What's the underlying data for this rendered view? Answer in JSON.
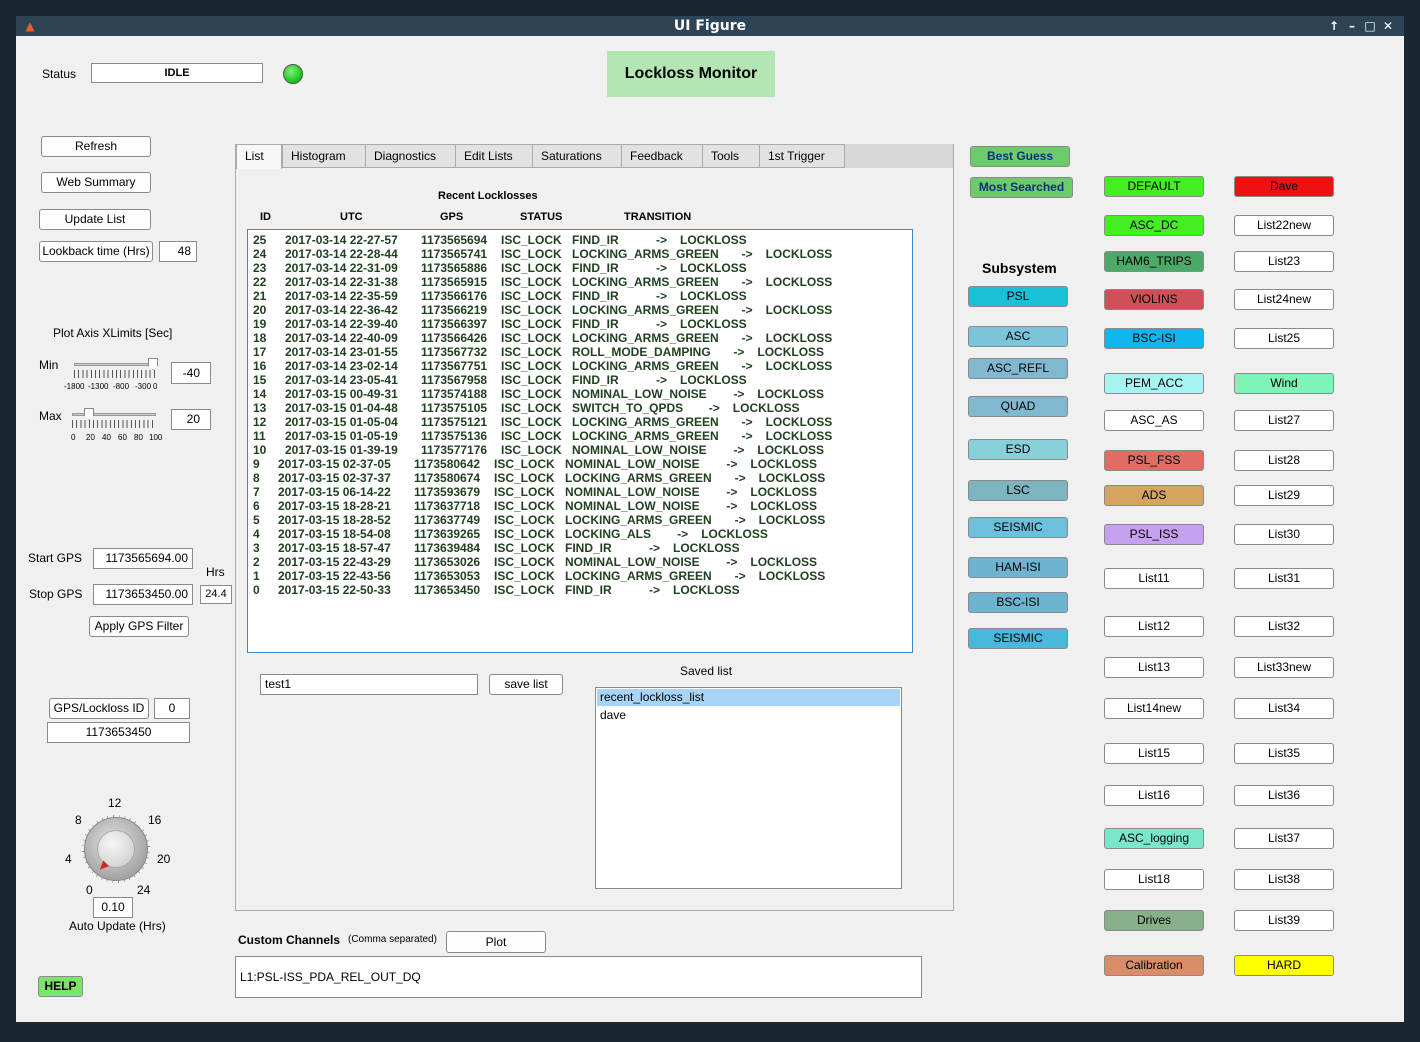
{
  "window": {
    "title": "UI Figure"
  },
  "status": {
    "label": "Status",
    "value": "IDLE",
    "indicator_color": "#22cc22"
  },
  "header": {
    "title": "Lockloss Monitor",
    "title_bg": "#b4e6b4"
  },
  "left": {
    "refresh": "Refresh",
    "web_summary": "Web Summary",
    "update_list": "Update List",
    "lookback_label": "Lookback time (Hrs)",
    "lookback_value": "48",
    "plot_axis_title": "Plot Axis XLimits [Sec]",
    "min_label": "Min",
    "min_value": "-40",
    "min_ticks": [
      "-1800",
      "-1300",
      "-800",
      "-300",
      "0"
    ],
    "max_label": "Max",
    "max_value": "20",
    "max_ticks": [
      "0",
      "20",
      "40",
      "60",
      "80",
      "100"
    ],
    "start_gps_label": "Start GPS",
    "start_gps_value": "1173565694.00",
    "stop_gps_label": "Stop GPS",
    "stop_gps_value": "1173653450.00",
    "hrs_label": "Hrs",
    "hrs_value": "24.4",
    "apply_gps": "Apply GPS Filter",
    "gps_id_label": "GPS/Lockloss ID",
    "gps_id_value": "0",
    "gps_value": "1173653450",
    "dial_ticks": [
      "0",
      "4",
      "8",
      "12",
      "16",
      "20",
      "24"
    ],
    "auto_update_value": "0.10",
    "auto_update_label": "Auto Update (Hrs)",
    "help": "HELP"
  },
  "tabs": [
    "List",
    "Histogram",
    "Diagnostics",
    "Edit Lists",
    "Saturations",
    "Feedback",
    "Tools",
    "1st Trigger"
  ],
  "list_panel": {
    "title": "Recent Locklosses",
    "columns": [
      "ID",
      "UTC",
      "GPS",
      "STATUS",
      "TRANSITION"
    ],
    "rows": [
      {
        "id": "25",
        "utc": "2017-03-14 22-27-57",
        "gps": "1173565694",
        "status": "ISC_LOCK",
        "from": "FIND_IR",
        "to": "LOCKLOSS"
      },
      {
        "id": "24",
        "utc": "2017-03-14 22-28-44",
        "gps": "1173565741",
        "status": "ISC_LOCK",
        "from": "LOCKING_ARMS_GREEN",
        "to": "LOCKLOSS"
      },
      {
        "id": "23",
        "utc": "2017-03-14 22-31-09",
        "gps": "1173565886",
        "status": "ISC_LOCK",
        "from": "FIND_IR",
        "to": "LOCKLOSS"
      },
      {
        "id": "22",
        "utc": "2017-03-14 22-31-38",
        "gps": "1173565915",
        "status": "ISC_LOCK",
        "from": "LOCKING_ARMS_GREEN",
        "to": "LOCKLOSS"
      },
      {
        "id": "21",
        "utc": "2017-03-14 22-35-59",
        "gps": "1173566176",
        "status": "ISC_LOCK",
        "from": "FIND_IR",
        "to": "LOCKLOSS"
      },
      {
        "id": "20",
        "utc": "2017-03-14 22-36-42",
        "gps": "1173566219",
        "status": "ISC_LOCK",
        "from": "LOCKING_ARMS_GREEN",
        "to": "LOCKLOSS"
      },
      {
        "id": "19",
        "utc": "2017-03-14 22-39-40",
        "gps": "1173566397",
        "status": "ISC_LOCK",
        "from": "FIND_IR",
        "to": "LOCKLOSS"
      },
      {
        "id": "18",
        "utc": "2017-03-14 22-40-09",
        "gps": "1173566426",
        "status": "ISC_LOCK",
        "from": "LOCKING_ARMS_GREEN",
        "to": "LOCKLOSS"
      },
      {
        "id": "17",
        "utc": "2017-03-14 23-01-55",
        "gps": "1173567732",
        "status": "ISC_LOCK",
        "from": "ROLL_MODE_DAMPING",
        "to": "LOCKLOSS"
      },
      {
        "id": "16",
        "utc": "2017-03-14 23-02-14",
        "gps": "1173567751",
        "status": "ISC_LOCK",
        "from": "LOCKING_ARMS_GREEN",
        "to": "LOCKLOSS"
      },
      {
        "id": "15",
        "utc": "2017-03-14 23-05-41",
        "gps": "1173567958",
        "status": "ISC_LOCK",
        "from": "FIND_IR",
        "to": "LOCKLOSS"
      },
      {
        "id": "14",
        "utc": "2017-03-15 00-49-31",
        "gps": "1173574188",
        "status": "ISC_LOCK",
        "from": "NOMINAL_LOW_NOISE",
        "to": "LOCKLOSS"
      },
      {
        "id": "13",
        "utc": "2017-03-15 01-04-48",
        "gps": "1173575105",
        "status": "ISC_LOCK",
        "from": "SWITCH_TO_QPDS",
        "to": "LOCKLOSS"
      },
      {
        "id": "12",
        "utc": "2017-03-15 01-05-04",
        "gps": "1173575121",
        "status": "ISC_LOCK",
        "from": "LOCKING_ARMS_GREEN",
        "to": "LOCKLOSS"
      },
      {
        "id": "11",
        "utc": "2017-03-15 01-05-19",
        "gps": "1173575136",
        "status": "ISC_LOCK",
        "from": "LOCKING_ARMS_GREEN",
        "to": "LOCKLOSS"
      },
      {
        "id": "10",
        "utc": "2017-03-15 01-39-19",
        "gps": "1173577176",
        "status": "ISC_LOCK",
        "from": "NOMINAL_LOW_NOISE",
        "to": "LOCKLOSS"
      },
      {
        "id": "9",
        "utc": "2017-03-15 02-37-05",
        "gps": "1173580642",
        "status": "ISC_LOCK",
        "from": "NOMINAL_LOW_NOISE",
        "to": "LOCKLOSS"
      },
      {
        "id": "8",
        "utc": "2017-03-15 02-37-37",
        "gps": "1173580674",
        "status": "ISC_LOCK",
        "from": "LOCKING_ARMS_GREEN",
        "to": "LOCKLOSS"
      },
      {
        "id": "7",
        "utc": "2017-03-15 06-14-22",
        "gps": "1173593679",
        "status": "ISC_LOCK",
        "from": "NOMINAL_LOW_NOISE",
        "to": "LOCKLOSS"
      },
      {
        "id": "6",
        "utc": "2017-03-15 18-28-21",
        "gps": "1173637718",
        "status": "ISC_LOCK",
        "from": "NOMINAL_LOW_NOISE",
        "to": "LOCKLOSS"
      },
      {
        "id": "5",
        "utc": "2017-03-15 18-28-52",
        "gps": "1173637749",
        "status": "ISC_LOCK",
        "from": "LOCKING_ARMS_GREEN",
        "to": "LOCKLOSS"
      },
      {
        "id": "4",
        "utc": "2017-03-15 18-54-08",
        "gps": "1173639265",
        "status": "ISC_LOCK",
        "from": "LOCKING_ALS",
        "to": "LOCKLOSS"
      },
      {
        "id": "3",
        "utc": "2017-03-15 18-57-47",
        "gps": "1173639484",
        "status": "ISC_LOCK",
        "from": "FIND_IR",
        "to": "LOCKLOSS"
      },
      {
        "id": "2",
        "utc": "2017-03-15 22-43-29",
        "gps": "1173653026",
        "status": "ISC_LOCK",
        "from": "NOMINAL_LOW_NOISE",
        "to": "LOCKLOSS"
      },
      {
        "id": "1",
        "utc": "2017-03-15 22-43-56",
        "gps": "1173653053",
        "status": "ISC_LOCK",
        "from": "LOCKING_ARMS_GREEN",
        "to": "LOCKLOSS"
      },
      {
        "id": "0",
        "utc": "2017-03-15 22-50-33",
        "gps": "1173653450",
        "status": "ISC_LOCK",
        "from": "FIND_IR",
        "to": "LOCKLOSS"
      }
    ],
    "arrow": "->",
    "list_name_value": "test1",
    "save_list": "save list",
    "saved_list_label": "Saved list",
    "saved_lists": [
      "recent_lockloss_list",
      "dave"
    ]
  },
  "custom": {
    "label": "Custom Channels",
    "hint": "(Comma separated)",
    "plot": "Plot",
    "value": "L1:PSL-ISS_PDA_REL_OUT_DQ"
  },
  "subsystem": {
    "best_guess": "Best Guess",
    "most_searched": "Most Searched",
    "title": "Subsystem",
    "buttons": [
      {
        "label": "PSL",
        "color": "#18c0d8"
      },
      {
        "label": "ASC",
        "color": "#7cc4dc"
      },
      {
        "label": "ASC_REFL",
        "color": "#80b8d0"
      },
      {
        "label": "QUAD",
        "color": "#80b8d0"
      },
      {
        "label": "ESD",
        "color": "#88d0d8"
      },
      {
        "label": "LSC",
        "color": "#7cb4c0"
      },
      {
        "label": "SEISMIC",
        "color": "#6cc0dc"
      },
      {
        "label": "HAM-ISI",
        "color": "#6cb4d0"
      },
      {
        "label": "BSC-ISI",
        "color": "#6cb4d0"
      },
      {
        "label": "SEISMIC",
        "color": "#48b8dc"
      }
    ]
  },
  "lists_col1": [
    {
      "label": "DEFAULT",
      "color": "#44ee22"
    },
    {
      "label": "ASC_DC",
      "color": "#44ee22"
    },
    {
      "label": "HAM6_TRIPS",
      "color": "#4caa68"
    },
    {
      "label": "VIOLINS",
      "color": "#d05058"
    },
    {
      "label": "BSC-ISI",
      "color": "#10b4ee"
    },
    {
      "label": "PEM_ACC",
      "color": "#a8f4f4"
    },
    {
      "label": "ASC_AS",
      "color": "#ffffff"
    },
    {
      "label": "PSL_FSS",
      "color": "#e06c64"
    },
    {
      "label": "ADS",
      "color": "#d4a460"
    },
    {
      "label": "PSL_ISS",
      "color": "#c8a0f0"
    },
    {
      "label": "List11",
      "color": "#ffffff"
    },
    {
      "label": "List12",
      "color": "#ffffff"
    },
    {
      "label": "List13",
      "color": "#ffffff"
    },
    {
      "label": "List14new",
      "color": "#ffffff"
    },
    {
      "label": "List15",
      "color": "#ffffff"
    },
    {
      "label": "List16",
      "color": "#ffffff"
    },
    {
      "label": "ASC_logging",
      "color": "#78e8c8"
    },
    {
      "label": "List18",
      "color": "#ffffff"
    },
    {
      "label": "Drives",
      "color": "#88b088"
    },
    {
      "label": "Calibration",
      "color": "#d88c68"
    }
  ],
  "lists_col2": [
    {
      "label": "Dave",
      "color": "#ee1111"
    },
    {
      "label": "List22new",
      "color": "#ffffff"
    },
    {
      "label": "List23",
      "color": "#ffffff"
    },
    {
      "label": "List24new",
      "color": "#ffffff"
    },
    {
      "label": "List25",
      "color": "#ffffff"
    },
    {
      "label": "Wind",
      "color": "#80f4b8"
    },
    {
      "label": "List27",
      "color": "#ffffff"
    },
    {
      "label": "List28",
      "color": "#ffffff"
    },
    {
      "label": "List29",
      "color": "#ffffff"
    },
    {
      "label": "List30",
      "color": "#ffffff"
    },
    {
      "label": "List31",
      "color": "#ffffff"
    },
    {
      "label": "List32",
      "color": "#ffffff"
    },
    {
      "label": "List33new",
      "color": "#ffffff"
    },
    {
      "label": "List34",
      "color": "#ffffff"
    },
    {
      "label": "List35",
      "color": "#ffffff"
    },
    {
      "label": "List36",
      "color": "#ffffff"
    },
    {
      "label": "List37",
      "color": "#ffffff"
    },
    {
      "label": "List38",
      "color": "#ffffff"
    },
    {
      "label": "List39",
      "color": "#ffffff"
    },
    {
      "label": "HARD",
      "color": "#ffff00"
    }
  ]
}
